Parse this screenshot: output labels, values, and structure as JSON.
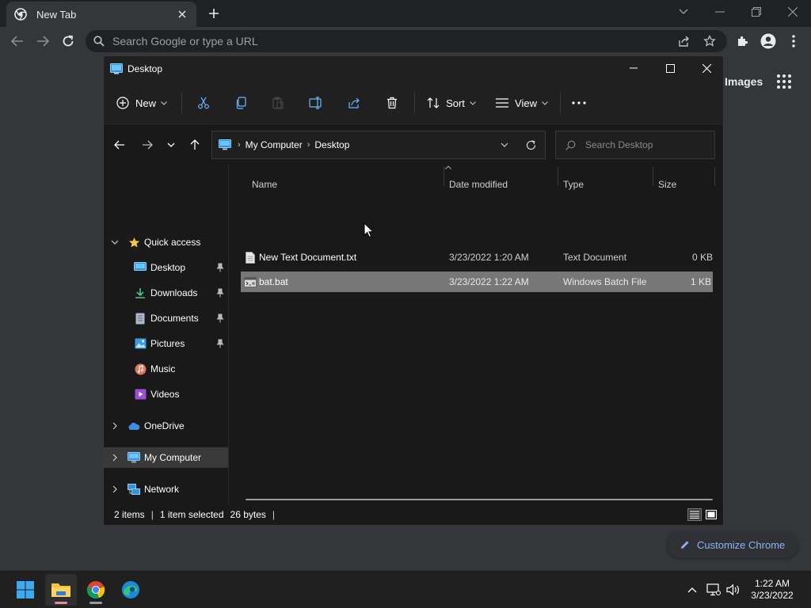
{
  "browser": {
    "tab_title": "New Tab",
    "omnibox_placeholder": "Search Google or type a URL",
    "ntp_images_link": "Images",
    "customize_label": "Customize Chrome"
  },
  "explorer": {
    "window_title": "Desktop",
    "toolbar": {
      "new_label": "New",
      "sort_label": "Sort",
      "view_label": "View"
    },
    "breadcrumb": [
      "My Computer",
      "Desktop"
    ],
    "search_placeholder": "Search Desktop",
    "sidebar": {
      "quick_access": "Quick access",
      "pinned": [
        {
          "label": "Desktop",
          "icon": "desktop-icon",
          "pinned": true
        },
        {
          "label": "Downloads",
          "icon": "downloads-icon",
          "pinned": true
        },
        {
          "label": "Documents",
          "icon": "documents-icon",
          "pinned": true
        },
        {
          "label": "Pictures",
          "icon": "pictures-icon",
          "pinned": true
        },
        {
          "label": "Music",
          "icon": "music-icon",
          "pinned": false
        },
        {
          "label": "Videos",
          "icon": "videos-icon",
          "pinned": false
        }
      ],
      "onedrive": "OneDrive",
      "my_computer": "My Computer",
      "network": "Network"
    },
    "columns": {
      "name": "Name",
      "date_modified": "Date modified",
      "type": "Type",
      "size": "Size"
    },
    "files": [
      {
        "name": "New Text Document.txt",
        "date": "3/23/2022 1:20 AM",
        "type": "Text Document",
        "size": "0 KB",
        "selected": false
      },
      {
        "name": "bat.bat",
        "date": "3/23/2022 1:22 AM",
        "type": "Windows Batch File",
        "size": "1 KB",
        "selected": true
      }
    ],
    "status": {
      "items": "2 items",
      "selected": "1 item selected",
      "bytes": "26 bytes"
    }
  },
  "taskbar": {
    "time": "1:22 AM",
    "date": "3/23/2022"
  },
  "colors": {
    "accent": "#0078d4",
    "selection": "#777777",
    "sidebar_selected": "#393939"
  }
}
